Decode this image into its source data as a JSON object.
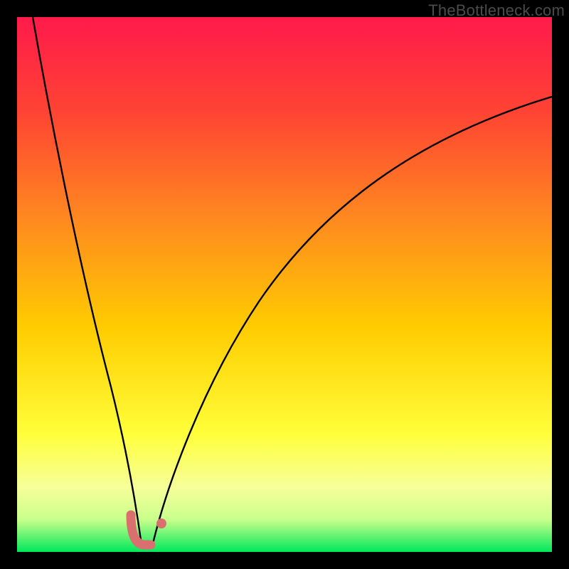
{
  "watermark": "TheBottleneck.com",
  "colors": {
    "frame": "#000000",
    "gradient_top": "#ff1a4b",
    "gradient_mid1": "#ff6a2a",
    "gradient_mid2": "#ffcc00",
    "gradient_mid3": "#ffff4d",
    "gradient_pale": "#f5ffb0",
    "gradient_bottom": "#00e85c",
    "curve": "#000000",
    "marker": "#d9706f"
  },
  "chart_data": {
    "type": "line",
    "title": "",
    "xlabel": "",
    "ylabel": "",
    "xlim": [
      0,
      100
    ],
    "ylim": [
      0,
      100
    ],
    "series": [
      {
        "name": "left-branch",
        "x": [
          3,
          5,
          7,
          9,
          11,
          13,
          15,
          17,
          19,
          20.5,
          22,
          23
        ],
        "y": [
          100,
          86,
          73,
          61,
          50,
          40,
          31,
          22,
          13,
          7,
          2.5,
          0.5
        ]
      },
      {
        "name": "right-branch",
        "x": [
          25,
          27,
          30,
          34,
          39,
          45,
          52,
          60,
          69,
          79,
          90,
          100
        ],
        "y": [
          0.5,
          6,
          15,
          26,
          37,
          47,
          56,
          64,
          71,
          77,
          82,
          85
        ]
      }
    ],
    "markers": [
      {
        "name": "L-shape-marker",
        "approx_x": 22.5,
        "approx_y": 3,
        "color": "#d9706f"
      },
      {
        "name": "dot-marker",
        "approx_x": 26.6,
        "approx_y": 5,
        "color": "#d9706f"
      }
    ],
    "background_gradient_meaning": "vertical red-to-green heat gradient (top=worst, bottom=best)"
  }
}
